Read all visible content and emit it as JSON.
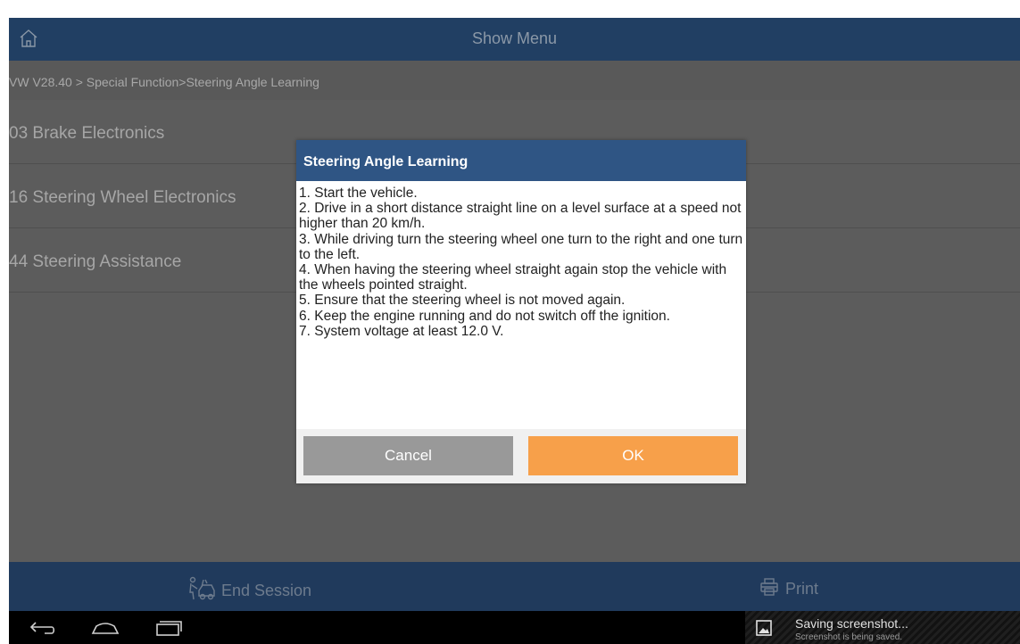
{
  "header": {
    "title": "Show Menu",
    "home_icon": "home-icon"
  },
  "breadcrumb": "VW V28.40 > Special Function>Steering Angle Learning",
  "menu": {
    "items": [
      {
        "label": "03 Brake Electronics"
      },
      {
        "label": "16 Steering Wheel Electronics"
      },
      {
        "label": "44 Steering Assistance"
      }
    ]
  },
  "dialog": {
    "title": "Steering Angle Learning",
    "lines": [
      "1. Start the vehicle.",
      "2. Drive in a short distance straight line on a level surface at a speed not higher than 20 km/h.",
      "3. While driving turn the steering wheel one turn to the right and one turn to the left.",
      "4. When having the steering wheel straight again stop the vehicle with the wheels pointed straight.",
      "5. Ensure that the steering wheel is not moved again.",
      "6. Keep the engine running and do not switch off the ignition.",
      "7. System voltage at least 12.0 V."
    ],
    "cancel_label": "Cancel",
    "ok_label": "OK"
  },
  "footer": {
    "end_session_label": "End Session",
    "print_label": "Print"
  },
  "system": {
    "notification_title": "Saving screenshot...",
    "notification_subtitle": "Screenshot is being saved."
  },
  "colors": {
    "header_bg": "#213f63",
    "dialog_header": "#2f5584",
    "ok_button": "#f7a04a",
    "cancel_button": "#999999"
  }
}
